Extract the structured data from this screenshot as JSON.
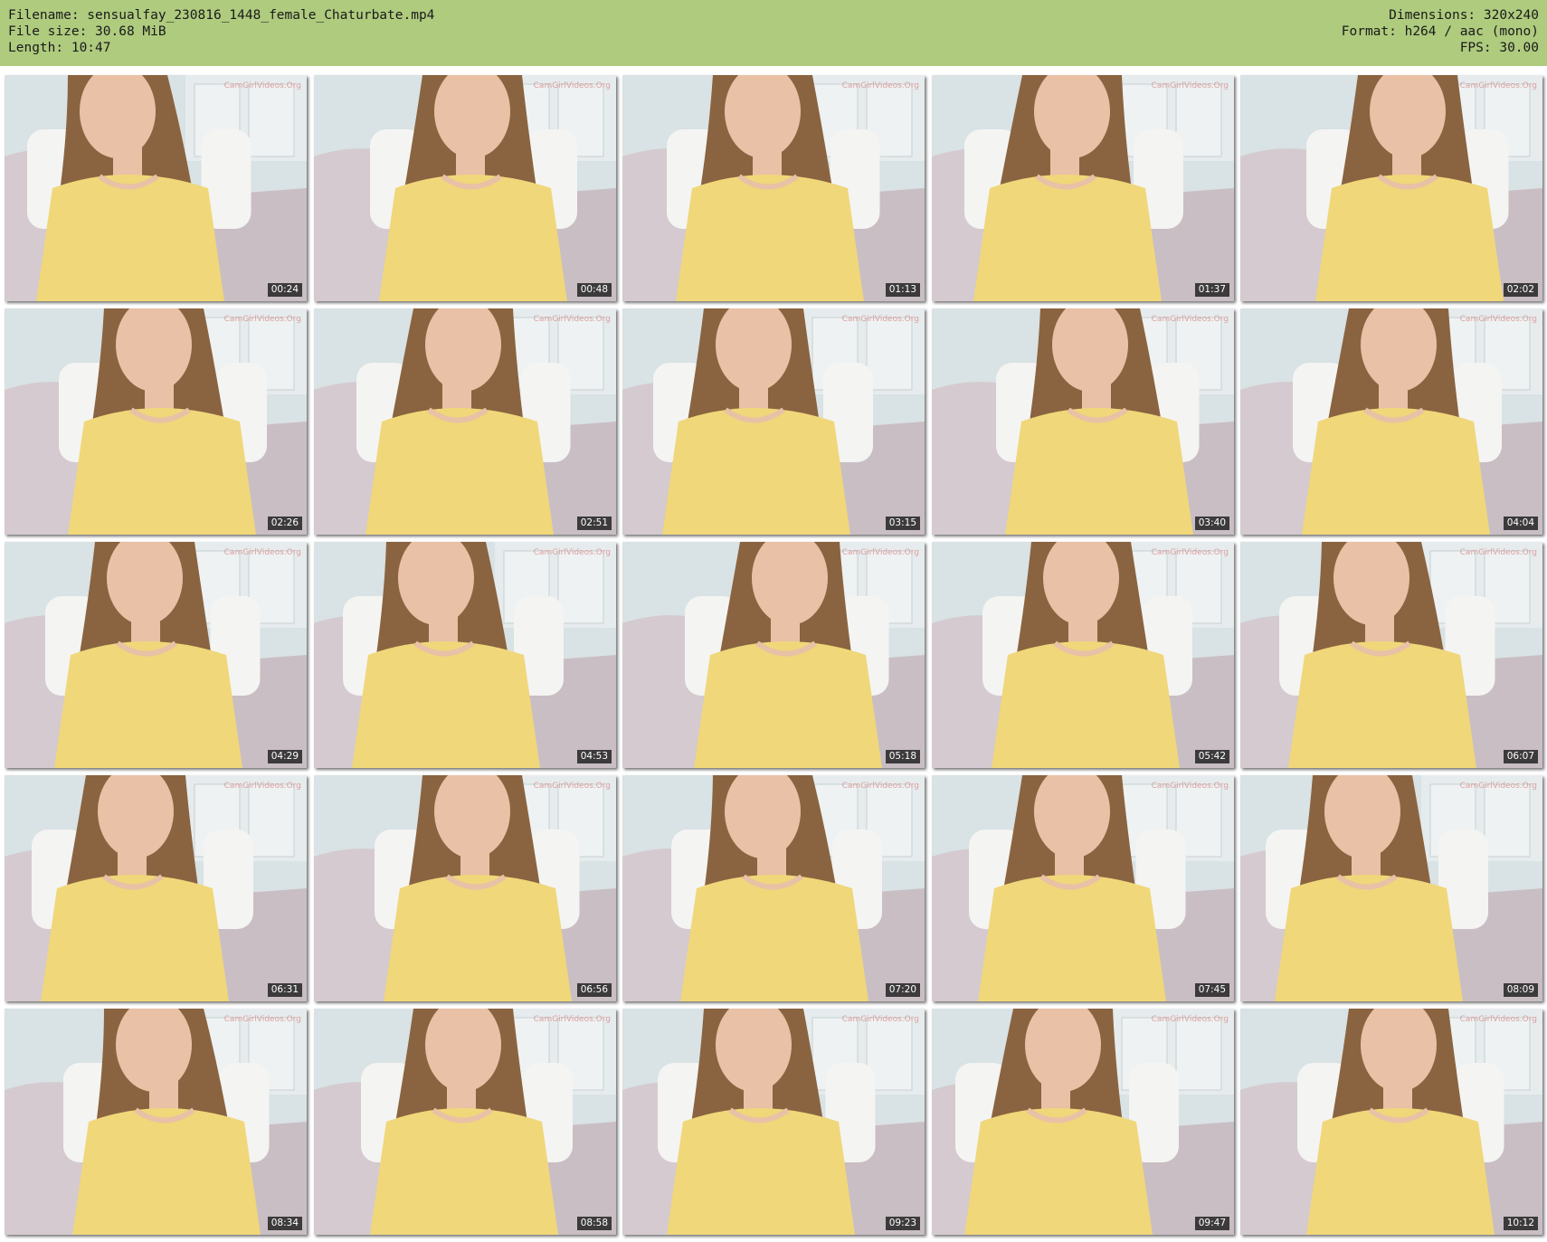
{
  "header": {
    "filename_line": "Filename: sensualfay_230816_1448_female_Chaturbate.mp4",
    "filesize_line": "File size: 30.68 MiB",
    "length_line": "Length: 10:47",
    "dimensions_line": "Dimensions: 320x240",
    "format_line": "Format: h264 / aac (mono)",
    "fps_line": "FPS: 30.00",
    "background_color": "#aecb7e"
  },
  "thumbnails": [
    {
      "time": "00:24"
    },
    {
      "time": "00:48"
    },
    {
      "time": "01:13"
    },
    {
      "time": "01:37"
    },
    {
      "time": "02:02"
    },
    {
      "time": "02:26"
    },
    {
      "time": "02:51"
    },
    {
      "time": "03:15"
    },
    {
      "time": "03:40"
    },
    {
      "time": "04:04"
    },
    {
      "time": "04:29"
    },
    {
      "time": "04:53"
    },
    {
      "time": "05:18"
    },
    {
      "time": "05:42"
    },
    {
      "time": "06:07"
    },
    {
      "time": "06:31"
    },
    {
      "time": "06:56"
    },
    {
      "time": "07:20"
    },
    {
      "time": "07:45"
    },
    {
      "time": "08:09"
    },
    {
      "time": "08:34"
    },
    {
      "time": "08:58"
    },
    {
      "time": "09:23"
    },
    {
      "time": "09:47"
    },
    {
      "time": "10:12"
    }
  ],
  "watermark": "CamGirlVideos.Org",
  "colors": {
    "shirt": "#f0d77a",
    "hair": "#8a6440",
    "skin": "#e9c1a6",
    "wall": "#d9e2e4",
    "sofa": "#c9bec4"
  }
}
